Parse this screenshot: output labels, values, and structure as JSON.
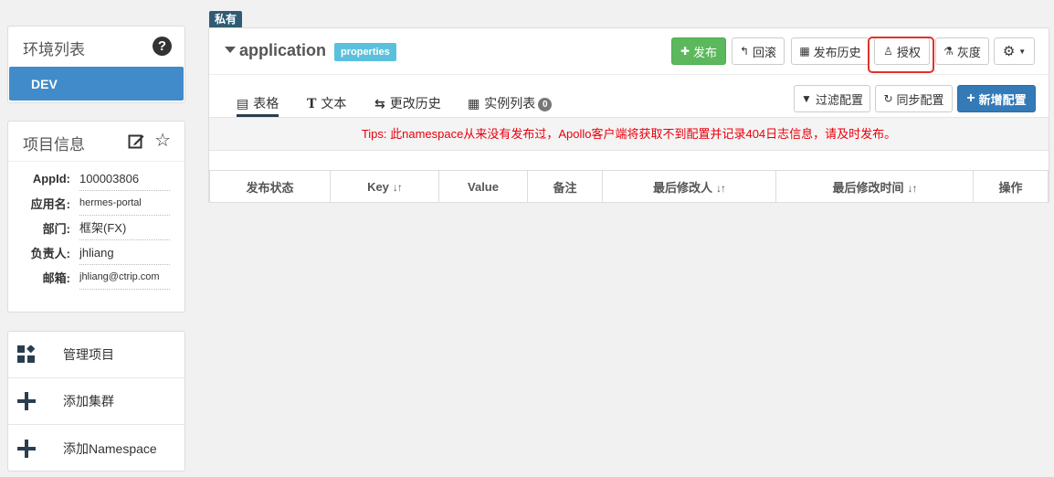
{
  "sidebar": {
    "env_panel": {
      "title": "环境列表",
      "help_icon": "?",
      "env": "DEV"
    },
    "info_panel": {
      "title": "项目信息",
      "rows": [
        {
          "label": "AppId:",
          "value": "100003806"
        },
        {
          "label": "应用名:",
          "value": "hermes-portal"
        },
        {
          "label": "部门:",
          "value": "框架(FX)"
        },
        {
          "label": "负责人:",
          "value": "jhliang"
        },
        {
          "label": "邮箱:",
          "value": "jhliang@ctrip.com"
        }
      ]
    },
    "actions": [
      {
        "label": "管理项目",
        "icon": "grid-icon"
      },
      {
        "label": "添加集群",
        "icon": "plus-icon"
      },
      {
        "label": "添加Namespace",
        "icon": "plus-icon"
      }
    ]
  },
  "namespace": {
    "private_tag": "私有",
    "name": "application",
    "format": "properties",
    "buttons": {
      "publish": "发布",
      "rollback": "回滚",
      "history": "发布历史",
      "grant": "授权",
      "gray": "灰度"
    },
    "tabs": [
      {
        "icon": "table-icon",
        "label": "表格"
      },
      {
        "icon": "text-icon",
        "label": "文本"
      },
      {
        "icon": "history-icon",
        "label": "更改历史"
      },
      {
        "icon": "instances-icon",
        "label": "实例列表",
        "count": "0"
      }
    ],
    "tools": {
      "filter": "过滤配置",
      "sync": "同步配置",
      "add": "新增配置"
    },
    "tips": "Tips: 此namespace从来没有发布过，Apollo客户端将获取不到配置并记录404日志信息，请及时发布。",
    "table_headers": [
      "发布状态",
      "Key",
      "Value",
      "备注",
      "最后修改人",
      "最后修改时间",
      "操作"
    ]
  },
  "colors": {
    "primary": "#428bca",
    "success": "#5cb85c",
    "info": "#5bc0de",
    "danger": "#e8000b",
    "highlight": "#e0332b"
  }
}
